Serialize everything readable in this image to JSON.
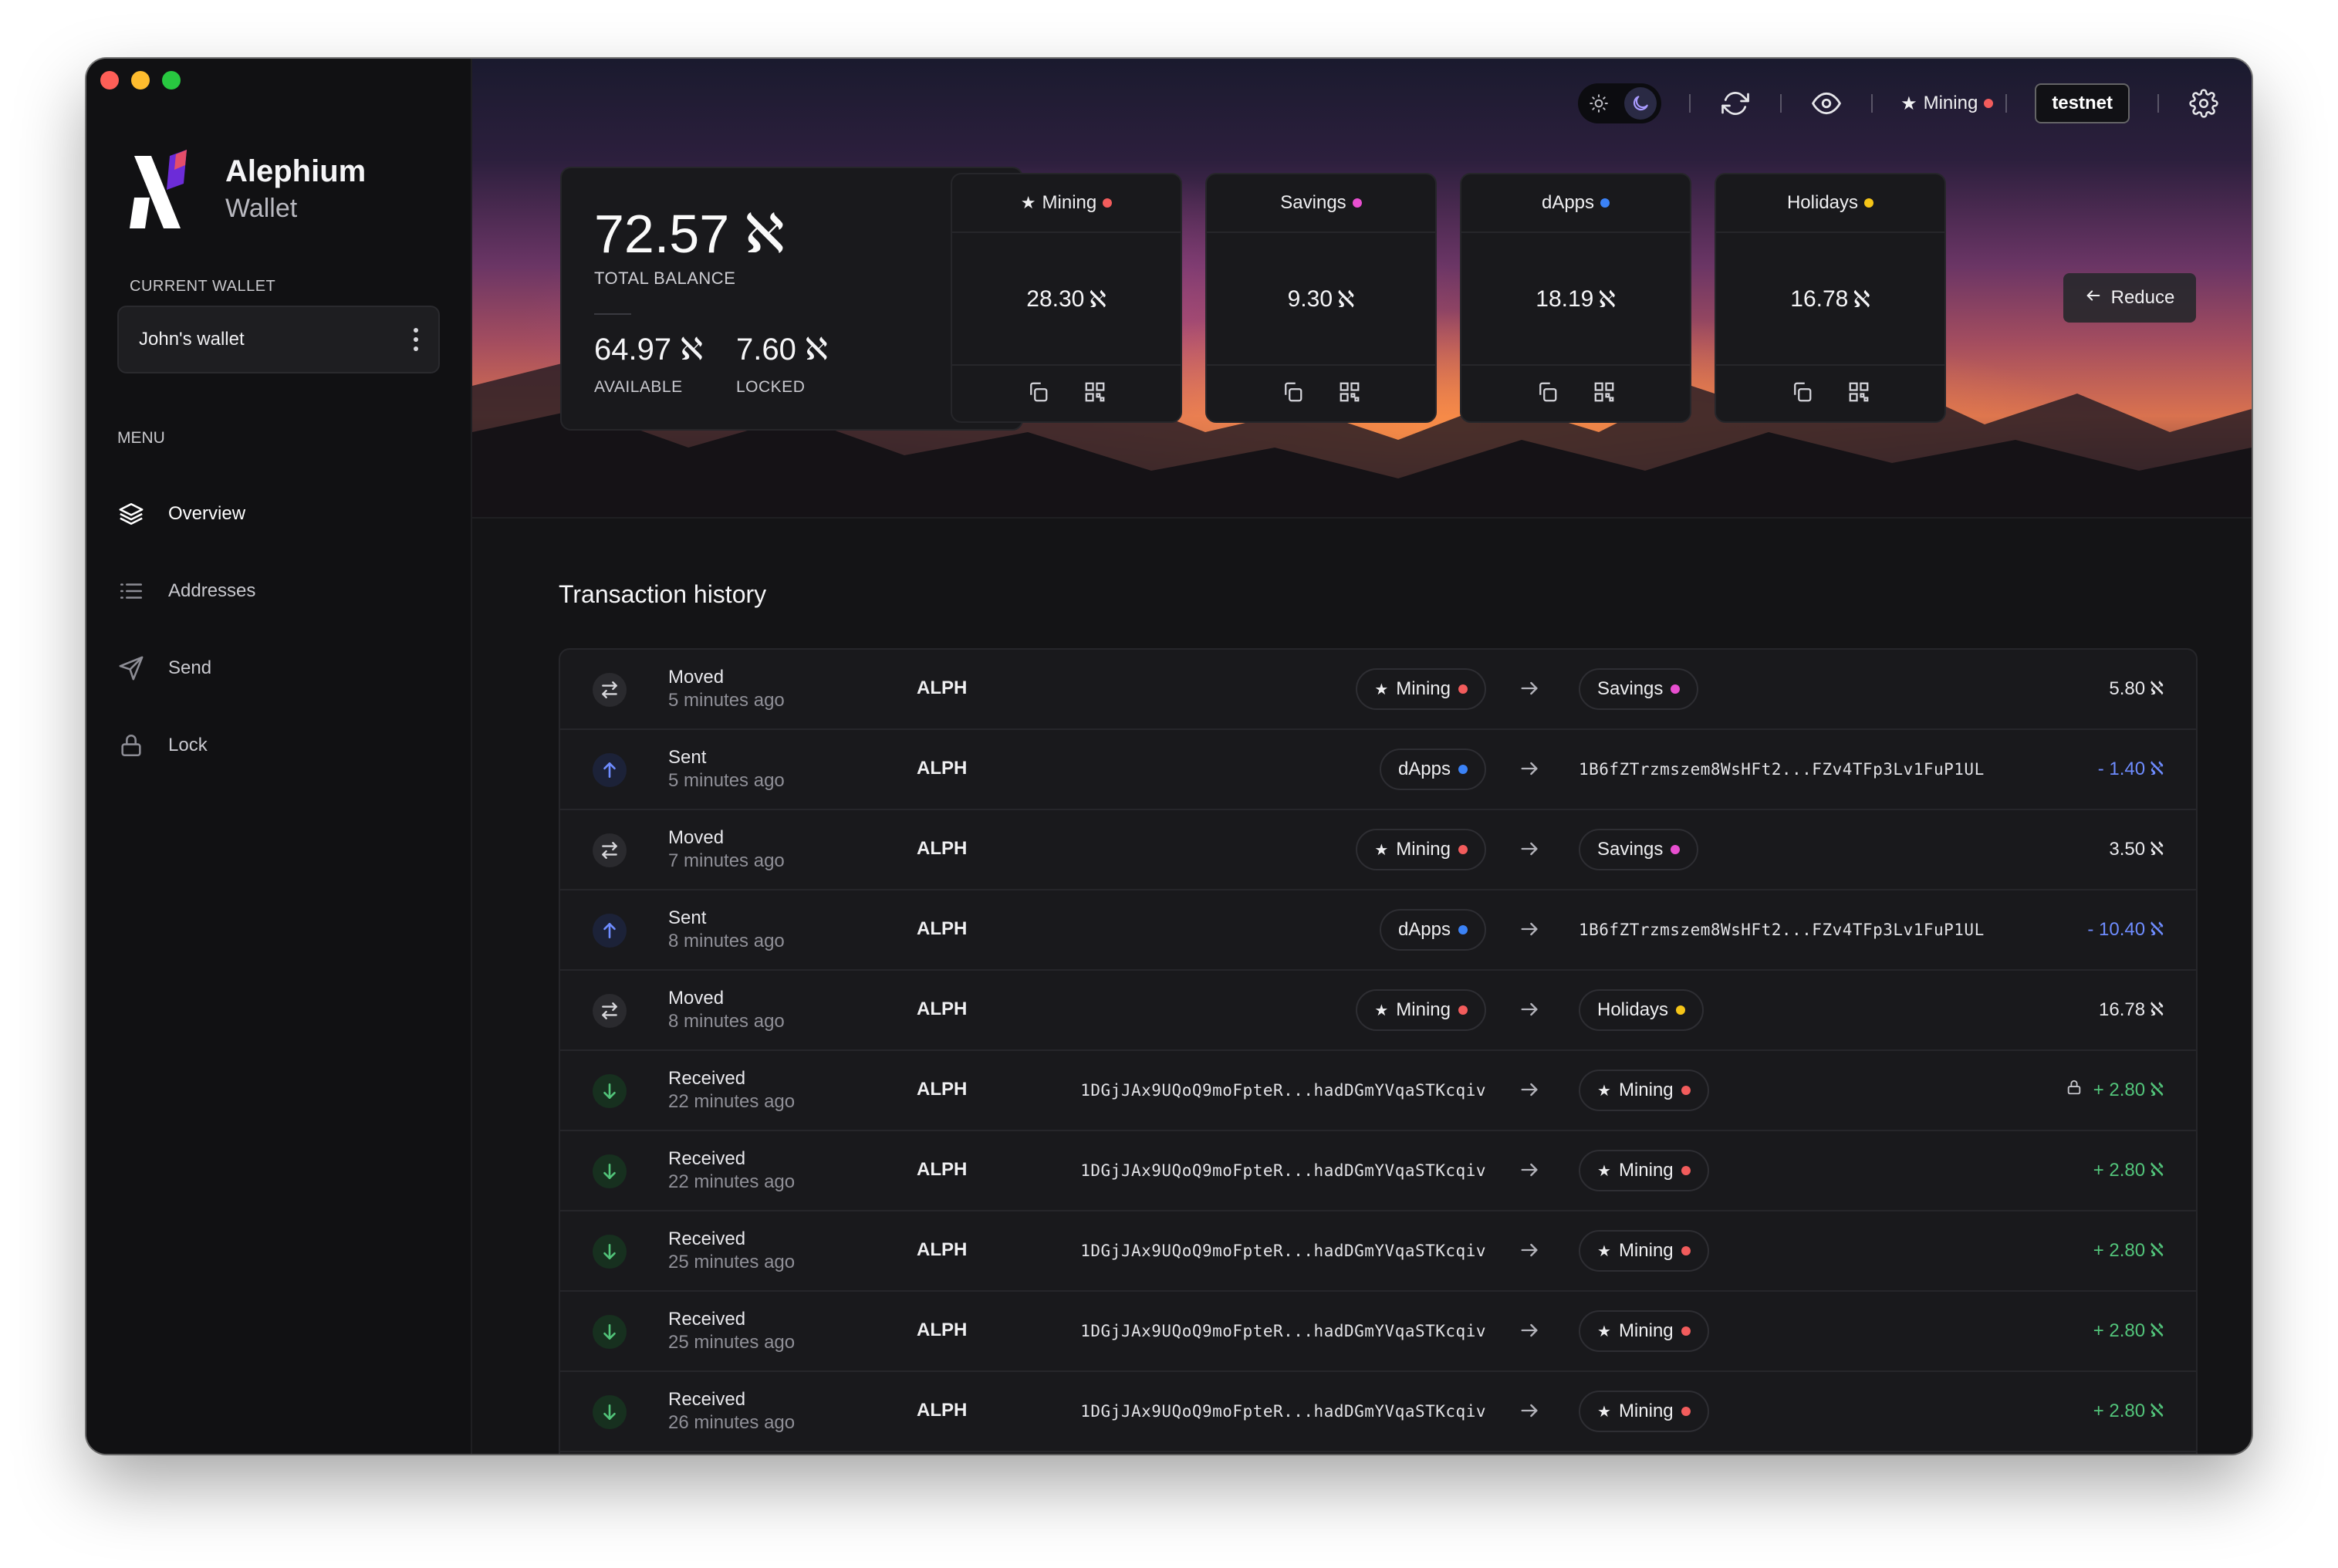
{
  "app": {
    "name": "Alephium",
    "subtitle": "Wallet",
    "current_wallet_label": "CURRENT WALLET",
    "wallet_name": "John's wallet",
    "menu_label": "MENU"
  },
  "menu": [
    {
      "label": "Overview",
      "icon": "layers-icon",
      "active": true
    },
    {
      "label": "Addresses",
      "icon": "list-icon",
      "active": false
    },
    {
      "label": "Send",
      "icon": "send-icon",
      "active": false
    },
    {
      "label": "Lock",
      "icon": "lock-icon",
      "active": false
    }
  ],
  "topbar": {
    "default_address": "Mining",
    "network": "testnet"
  },
  "balance": {
    "total": "72.57",
    "total_label": "TOTAL BALANCE",
    "available": "64.97",
    "available_label": "AVAILABLE",
    "locked": "7.60",
    "locked_label": "LOCKED",
    "currency_symbol": "ℵ"
  },
  "addresses": [
    {
      "label": "Mining",
      "amount": "28.30",
      "color": "#f25c5c",
      "starred": true
    },
    {
      "label": "Savings",
      "amount": "9.30",
      "color": "#e84fd0",
      "starred": false
    },
    {
      "label": "dApps",
      "amount": "18.19",
      "color": "#3b82f6",
      "starred": false
    },
    {
      "label": "Holidays",
      "amount": "16.78",
      "color": "#f5c518",
      "starred": false
    }
  ],
  "reduce_label": "Reduce",
  "transactions_title": "Transaction history",
  "transactions": [
    {
      "type": "Moved",
      "time": "5 minutes ago",
      "asset": "ALPH",
      "from": "Mining",
      "from_color": "#f25c5c",
      "from_starred": true,
      "to": "Savings",
      "to_color": "#e84fd0",
      "to_starred": false,
      "amount": "5.80",
      "direction": "moved"
    },
    {
      "type": "Sent",
      "time": "5 minutes ago",
      "asset": "ALPH",
      "from": "dApps",
      "from_color": "#3b82f6",
      "from_starred": false,
      "to_hash": "1B6fZTrzmszem8WsHFt2...FZv4TFp3Lv1FuP1UL",
      "amount": "- 1.40",
      "direction": "out"
    },
    {
      "type": "Moved",
      "time": "7 minutes ago",
      "asset": "ALPH",
      "from": "Mining",
      "from_color": "#f25c5c",
      "from_starred": true,
      "to": "Savings",
      "to_color": "#e84fd0",
      "to_starred": false,
      "amount": "3.50",
      "direction": "moved"
    },
    {
      "type": "Sent",
      "time": "8 minutes ago",
      "asset": "ALPH",
      "from": "dApps",
      "from_color": "#3b82f6",
      "from_starred": false,
      "to_hash": "1B6fZTrzmszem8WsHFt2...FZv4TFp3Lv1FuP1UL",
      "amount": "- 10.40",
      "direction": "out"
    },
    {
      "type": "Moved",
      "time": "8 minutes ago",
      "asset": "ALPH",
      "from": "Mining",
      "from_color": "#f25c5c",
      "from_starred": true,
      "to": "Holidays",
      "to_color": "#f5c518",
      "to_starred": false,
      "amount": "16.78",
      "direction": "moved"
    },
    {
      "type": "Received",
      "time": "22 minutes ago",
      "asset": "ALPH",
      "from_hash": "1DGjJAx9UQoQ9moFpteR...hadDGmYVqaSTKcqiv",
      "to": "Mining",
      "to_color": "#f25c5c",
      "to_starred": true,
      "amount": "+ 2.80",
      "direction": "in",
      "locked": true
    },
    {
      "type": "Received",
      "time": "22 minutes ago",
      "asset": "ALPH",
      "from_hash": "1DGjJAx9UQoQ9moFpteR...hadDGmYVqaSTKcqiv",
      "to": "Mining",
      "to_color": "#f25c5c",
      "to_starred": true,
      "amount": "+ 2.80",
      "direction": "in"
    },
    {
      "type": "Received",
      "time": "25 minutes ago",
      "asset": "ALPH",
      "from_hash": "1DGjJAx9UQoQ9moFpteR...hadDGmYVqaSTKcqiv",
      "to": "Mining",
      "to_color": "#f25c5c",
      "to_starred": true,
      "amount": "+ 2.80",
      "direction": "in"
    },
    {
      "type": "Received",
      "time": "25 minutes ago",
      "asset": "ALPH",
      "from_hash": "1DGjJAx9UQoQ9moFpteR...hadDGmYVqaSTKcqiv",
      "to": "Mining",
      "to_color": "#f25c5c",
      "to_starred": true,
      "amount": "+ 2.80",
      "direction": "in"
    },
    {
      "type": "Received",
      "time": "26 minutes ago",
      "asset": "ALPH",
      "from_hash": "1DGjJAx9UQoQ9moFpteR...hadDGmYVqaSTKcqiv",
      "to": "Mining",
      "to_color": "#f25c5c",
      "to_starred": true,
      "amount": "+ 2.80",
      "direction": "in"
    }
  ],
  "colors": {
    "moved_icon_bg": "#2a2a2e",
    "sent_icon_bg": "#1c2238",
    "received_icon_bg": "#17301f",
    "accent_blue": "#6e8cff",
    "accent_green": "#52c47a"
  }
}
